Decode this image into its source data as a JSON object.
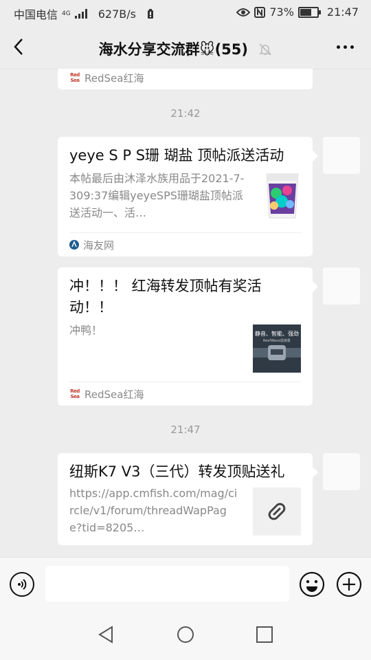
{
  "status_bar": {
    "carrier": "中国电信",
    "network": "4G",
    "speed": "627B/s",
    "battery": "73%",
    "battery_level": 0.73,
    "time": "21:47"
  },
  "header": {
    "title": "海水分享交流群🐭(55)"
  },
  "messages": [
    {
      "type": "link_card",
      "partial": true,
      "source": "RedSea红海",
      "source_logo": "Red Sea"
    },
    {
      "type": "timestamp",
      "text": "21:42"
    },
    {
      "type": "link_card",
      "title": "yeye S P S珊 瑚盐 顶帖派送活动",
      "desc": "本帖最后由沐泽水族用品于2021-7-309:37编辑yeyeSPS珊瑚盐顶帖派送活动一、活…",
      "source": "海友网",
      "thumbnail": "coral-salt-bucket-image"
    },
    {
      "type": "link_card",
      "title": "冲！！！ 红海转发顶帖有奖活动！！",
      "desc": "冲鸭！",
      "source": "RedSea红海",
      "source_logo": "Red Sea",
      "thumbnail": "redsea-pump-image",
      "thumbnail_text": "静音、智能、强劲",
      "thumbnail_subtext": "ReefWave造浪泵"
    },
    {
      "type": "timestamp",
      "text": "21:47"
    },
    {
      "type": "link_card",
      "title": "纽斯K7 V3（三代）转发顶贴送礼",
      "desc": "https://app.cmfish.com/mag/circle/v1/forum/threadWapPage?tid=8205…",
      "thumbnail": "link-icon"
    }
  ],
  "input_bar": {
    "message_input_value": "",
    "icons": [
      "voice-icon",
      "emoji-icon",
      "plus-icon"
    ]
  },
  "nav_bar": {
    "icons": [
      "back-triangle-icon",
      "home-circle-icon",
      "recents-square-icon"
    ]
  },
  "colors": {
    "background": "#ededed",
    "card": "#ffffff",
    "muted_text": "#888888",
    "timestamp_text": "#999999"
  }
}
